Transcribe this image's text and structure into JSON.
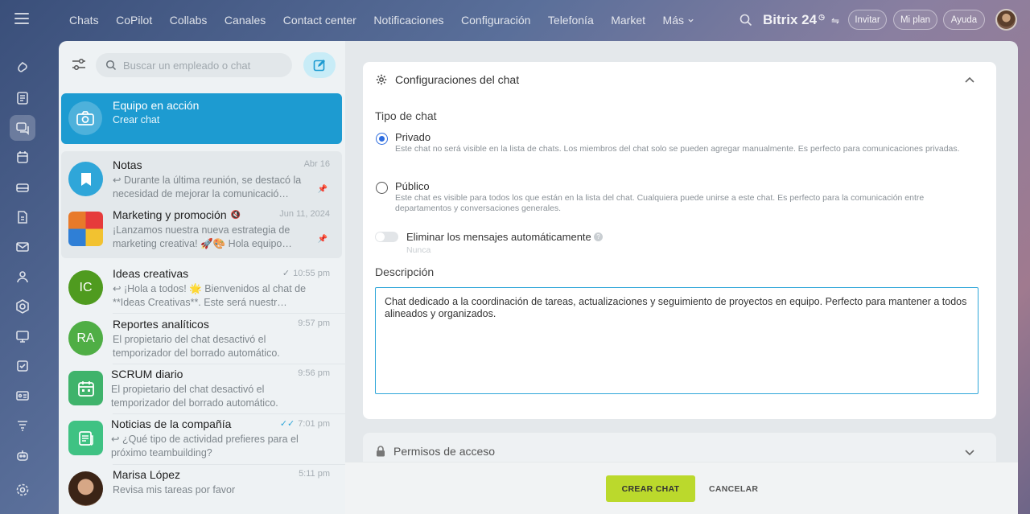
{
  "nav": {
    "items": [
      "Chats",
      "CoPilot",
      "Collabs",
      "Canales",
      "Contact center",
      "Notificaciones",
      "Configuración",
      "Telefonía",
      "Market",
      "Más"
    ],
    "brand": "Bitrix 24",
    "invite": "Invitar",
    "plan": "Mi plan",
    "help": "Ayuda"
  },
  "sidebar": {
    "search_placeholder": "Buscar un empleado o chat",
    "banner": {
      "title": "Equipo en acción",
      "subtitle": "Crear chat"
    },
    "chats": [
      {
        "name": "Notas",
        "time": "Abr 16",
        "message": "↩ Durante la última reunión, se destacó la necesidad de mejorar la comunicació…",
        "pinned": true
      },
      {
        "name": "Marketing y promoción",
        "time": "Jun 11, 2024",
        "message": "¡Lanzamos nuestra nueva estrategia de marketing creativa! 🚀🎨 Hola equipo…",
        "pinned": true
      },
      {
        "name": "Ideas creativas",
        "initials": "IC",
        "time": "10:55 pm",
        "message": "↩ ¡Hola a todos! 🌟 Bienvenidos al chat de **Ideas Creativas**. Este será nuestr…"
      },
      {
        "name": "Reportes analíticos",
        "initials": "RA",
        "time": "9:57 pm",
        "message": "El propietario del chat desactivó el temporizador del borrado automático."
      },
      {
        "name": "SCRUM diario",
        "time": "9:56 pm",
        "message": "El propietario del chat desactivó el temporizador del borrado automático."
      },
      {
        "name": "Noticias de la compañía",
        "time": "7:01 pm",
        "message": "↩ ¿Qué tipo de actividad prefieres para el próximo teambuilding?"
      },
      {
        "name": "Marisa López",
        "time": "5:11 pm",
        "message": "Revisa mis tareas por favor"
      }
    ],
    "colors": {
      "banner": "#1d9bd1",
      "ic": "#4f9b1f",
      "ra": "#4fae45",
      "scrum": "#3fb36b",
      "news": "#3fc283"
    }
  },
  "settings": {
    "title": "Configuraciones del chat",
    "type_label": "Tipo de chat",
    "private": {
      "title": "Privado",
      "description": "Este chat no será visible en la lista de chats. Los miembros del chat solo se pueden agregar manualmente. Es perfecto para comunicaciones privadas.",
      "selected": true
    },
    "public": {
      "title": "Público",
      "description": "Este chat es visible para todos los que están en la lista del chat. Cualquiera puede unirse a este chat. Es perfecto para la comunicación entre departamentos y conversaciones generales.",
      "selected": false
    },
    "autodelete": {
      "label": "Eliminar los mensajes automáticamente",
      "value": "Nunca",
      "enabled": false
    },
    "description_label": "Descripción",
    "description_value": "Chat dedicado a la coordinación de tareas, actualizaciones y seguimiento de proyectos en equipo. Perfecto para mantener a todos alineados y organizados."
  },
  "permissions": {
    "title": "Permisos de acceso"
  },
  "footer": {
    "create": "CREAR CHAT",
    "cancel": "CANCELAR"
  }
}
